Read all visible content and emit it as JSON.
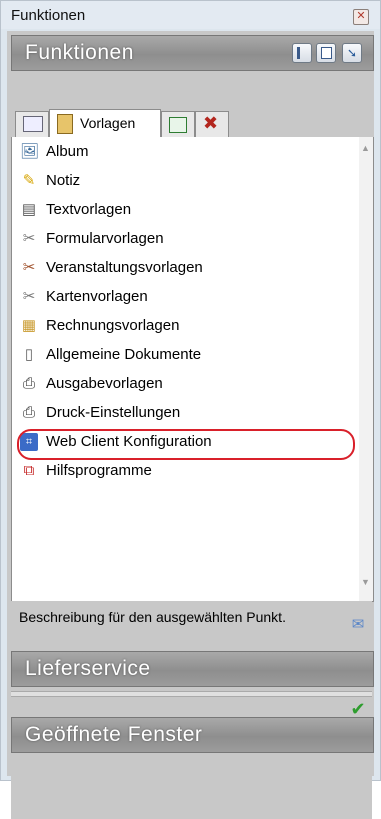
{
  "window": {
    "title": "Funktionen",
    "close_glyph": "✕"
  },
  "header": {
    "label": "Funktionen",
    "buttons": [
      "panel-left-icon",
      "panel-right-icon",
      "collapse-arrow-icon"
    ]
  },
  "tabs": [
    {
      "icon": "window-icon",
      "label": ""
    },
    {
      "icon": "templates-icon",
      "label": "Vorlagen",
      "active": true
    },
    {
      "icon": "list-icon",
      "label": ""
    },
    {
      "icon": "tools-icon",
      "label": ""
    }
  ],
  "items": [
    {
      "label": "Album",
      "icon": "album-icon",
      "glyph": "🖼"
    },
    {
      "label": "Notiz",
      "icon": "note-icon",
      "glyph": "✎"
    },
    {
      "label": "Textvorlagen",
      "icon": "text-template-icon",
      "glyph": "▤"
    },
    {
      "label": "Formularvorlagen",
      "icon": "form-template-icon",
      "glyph": "✂"
    },
    {
      "label": "Veranstaltungsvorlagen",
      "icon": "event-template-icon",
      "glyph": "✂"
    },
    {
      "label": "Kartenvorlagen",
      "icon": "card-template-icon",
      "glyph": "✂"
    },
    {
      "label": "Rechnungsvorlagen",
      "icon": "invoice-template-icon",
      "glyph": "▦"
    },
    {
      "label": "Allgemeine Dokumente",
      "icon": "document-icon",
      "glyph": "▯"
    },
    {
      "label": "Ausgabevorlagen",
      "icon": "printer-icon",
      "glyph": "⎙"
    },
    {
      "label": "Druck-Einstellungen",
      "icon": "printer-settings-icon",
      "glyph": "⎙"
    },
    {
      "label": "Web Client Konfiguration",
      "icon": "html-icon",
      "glyph": "⌗"
    },
    {
      "label": "Hilfsprogramme",
      "icon": "toolbox-icon",
      "glyph": "⧉"
    }
  ],
  "description": {
    "text": "Beschreibung für den ausgewählten Punkt.",
    "side_icons": [
      "mail-icon",
      "comment-icon",
      "check-icon"
    ]
  },
  "sections": [
    {
      "label": "Lieferservice"
    },
    {
      "label": "Geöffnete Fenster"
    }
  ],
  "colors": {
    "highlight": "#d9202a",
    "header_gradient": "#9c9c9c"
  }
}
